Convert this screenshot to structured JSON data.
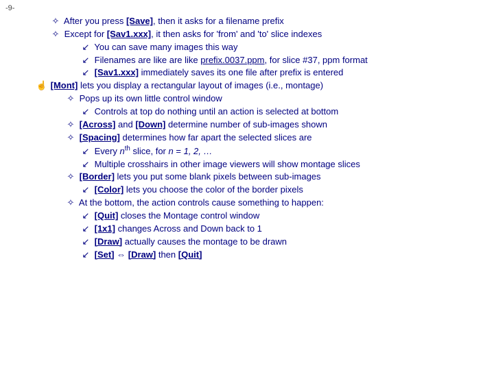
{
  "page": {
    "number": "-9-"
  },
  "lines": {
    "0": {
      "a": "After you press",
      "btn": "[Save]",
      "b": ", then it asks for a filename prefix"
    },
    "1": {
      "a": "Except for",
      "btn": "[Sav1.xxx]",
      "b": ", it then asks for 'from' and 'to' slice indexes"
    },
    "2": {
      "a": " You can save many images this way"
    },
    "3": {
      "a": " Filenames are like are like",
      "u": "prefix.0037.ppm",
      "b": ", for slice #37, ppm format"
    },
    "4": {
      "btn": "[Sav1.xxx]",
      "a": "immediately saves its one file after prefix is entered"
    },
    "5": {
      "btn": "[Mont]",
      "a": "lets you display a rectangular layout of images (i.e., montage)"
    },
    "6": {
      "a": "Pops up its own little control window"
    },
    "7": {
      "a": "Controls at top do nothing until an action is selected at bottom"
    },
    "8": {
      "btn1": "[Across]",
      "a": "and",
      "btn2": "[Down]",
      "b": "determine number of sub-images shown"
    },
    "9": {
      "btn": "[Spacing]",
      "a": "determines how far apart the selected slices are"
    },
    "10": {
      "a": "Every",
      "n": "n",
      "sup": "th",
      "b": "slice, for",
      "n2": "n",
      "c": "=",
      "seq": "1, 2, …"
    },
    "11": {
      "a": "Multiple crosshairs in other image viewers will show montage slices"
    },
    "12": {
      "btn": "[Border]",
      "a": "lets you put some blank pixels between sub-images"
    },
    "13": {
      "btn": "[Color]",
      "a": "lets you choose the color of the border pixels"
    },
    "14": {
      "a": "At the bottom, the action controls cause something to happen:"
    },
    "15": {
      "btn": "[Quit]",
      "a": "closes the Montage control window"
    },
    "16": {
      "btn": "[1x1]",
      "a": "changes Across and Down back to 1"
    },
    "17": {
      "btn": "[Draw]",
      "a": "actually causes the montage to be drawn"
    },
    "18": {
      "btn1": "[Set]",
      "arrow": "⇔",
      "btn2": "[Draw]",
      "a": "then",
      "btn3": "[Quit]"
    }
  }
}
